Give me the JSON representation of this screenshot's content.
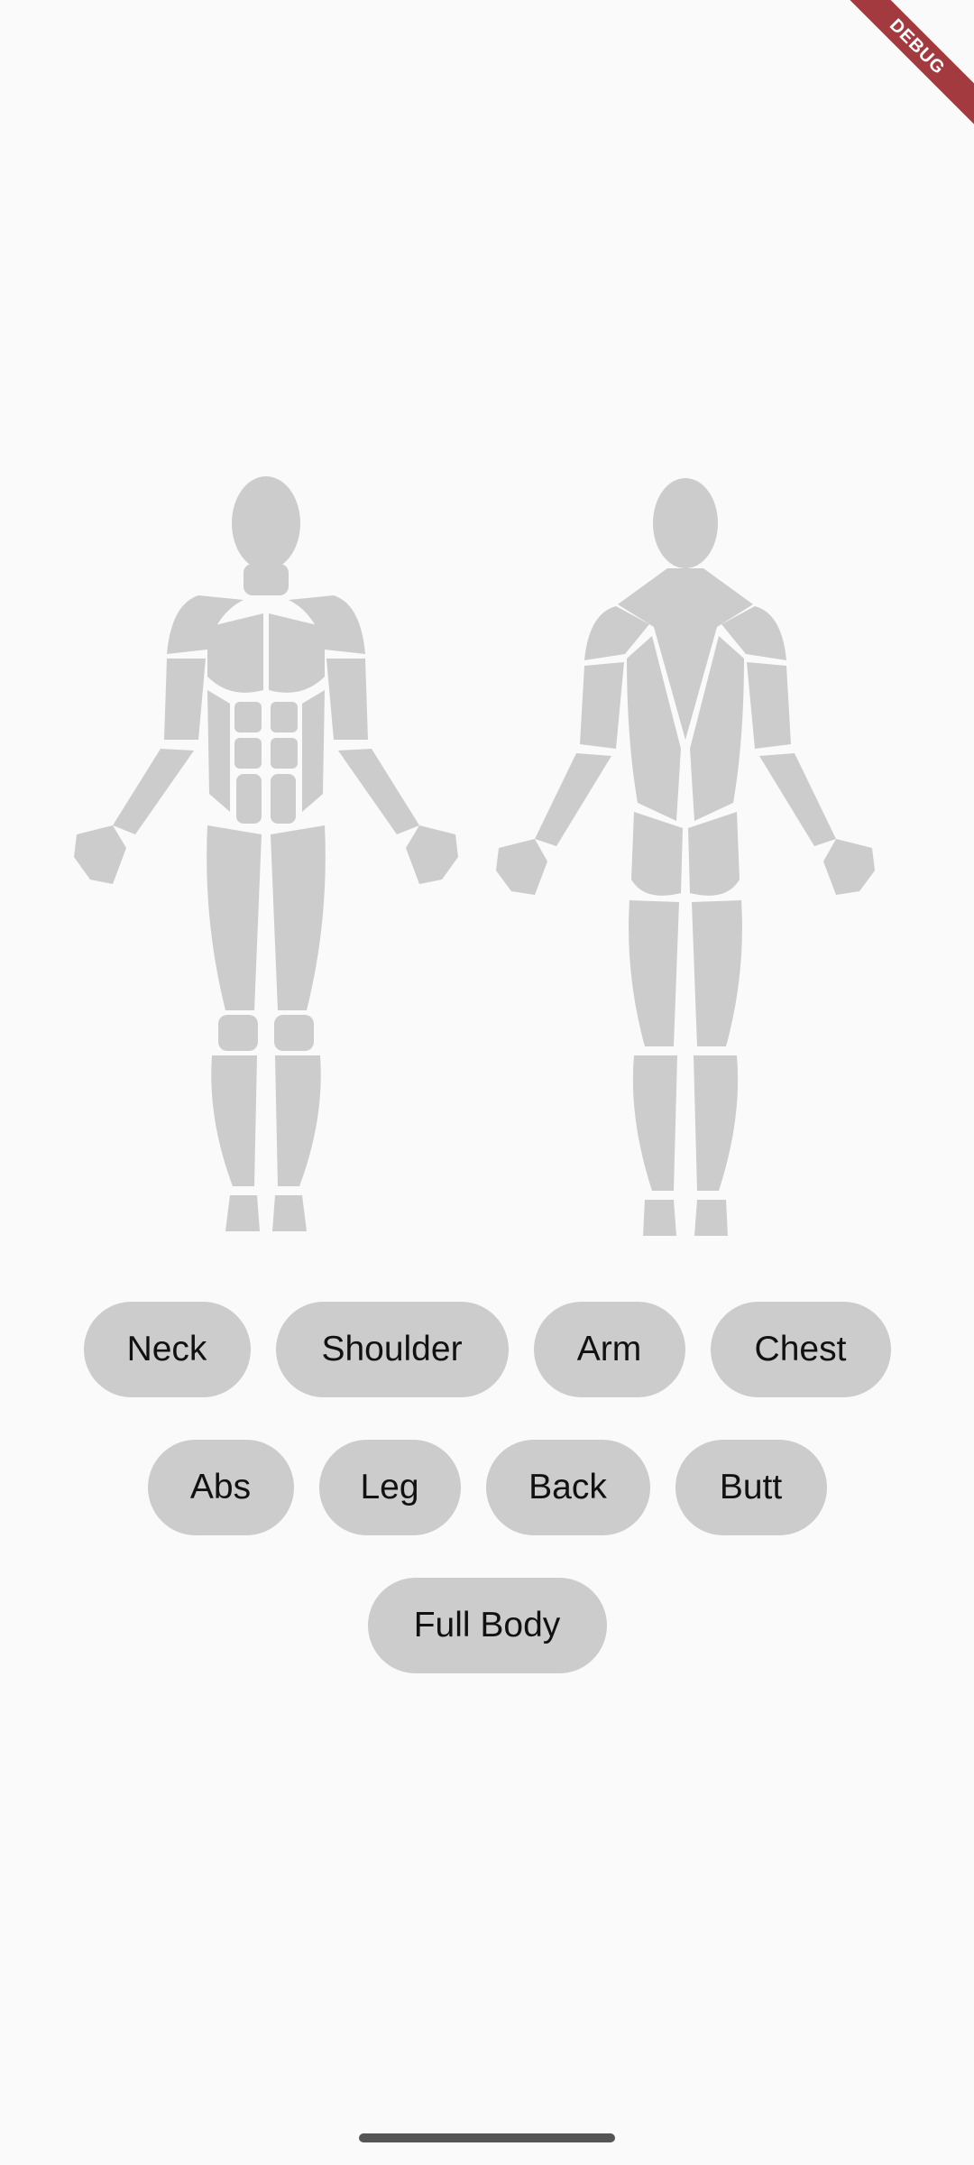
{
  "debug_banner": {
    "label": "DEBUG",
    "color": "#a33a3f"
  },
  "figures": {
    "front": {
      "icon": "front-muscle-body-icon"
    },
    "back": {
      "icon": "back-muscle-body-icon"
    }
  },
  "body_parts": {
    "row1": [
      "Neck",
      "Shoulder",
      "Arm",
      "Chest"
    ],
    "row2": [
      "Abs",
      "Leg",
      "Back",
      "Butt"
    ],
    "row3": [
      "Full Body"
    ]
  },
  "colors": {
    "chip_bg": "#cccccc",
    "muscle": "#cccccc",
    "background": "#fafafa",
    "text": "#111111"
  }
}
